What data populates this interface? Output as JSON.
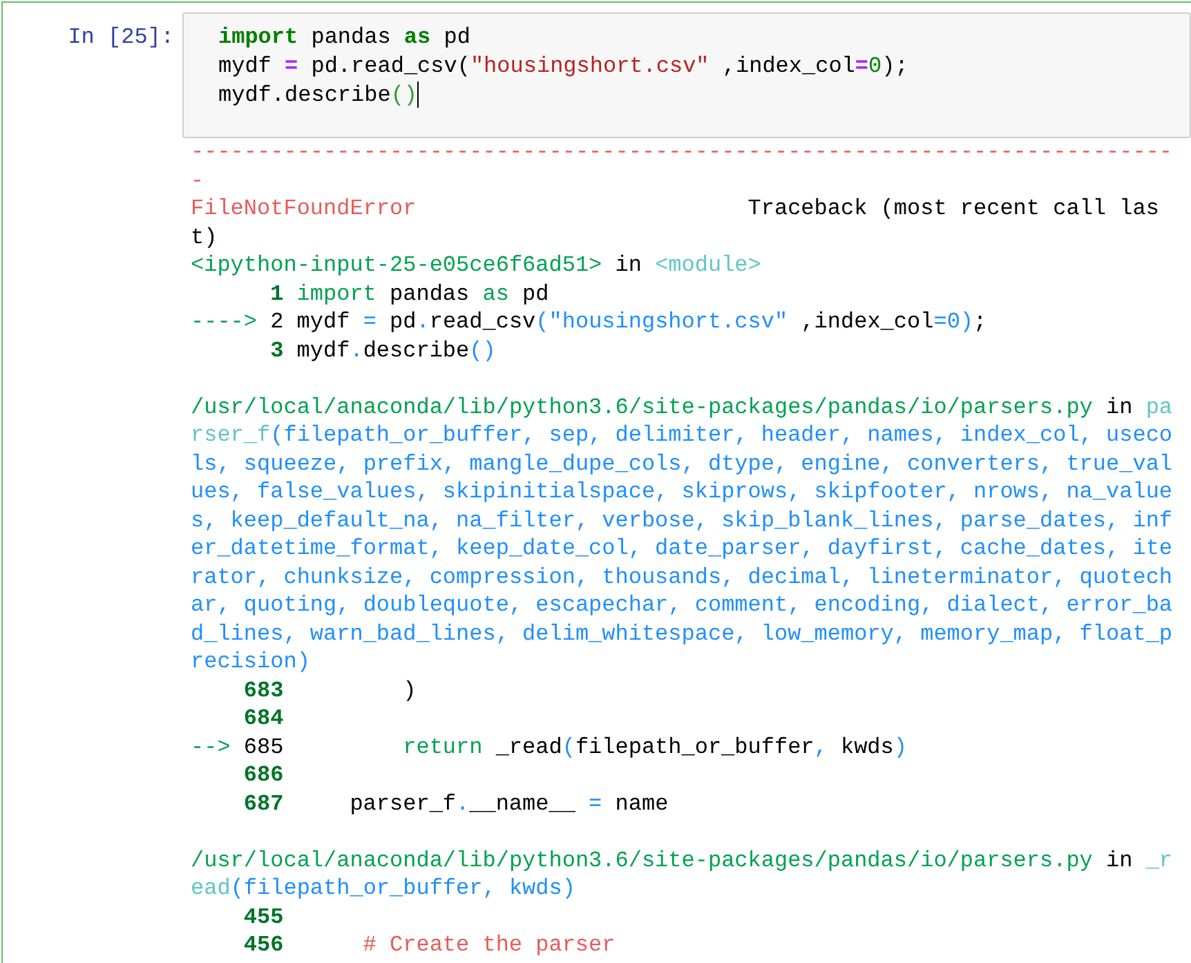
{
  "cell": {
    "selected": true,
    "prompt": "In [25]:",
    "input": {
      "cursor": true,
      "lines": [
        [
          {
            "kind": "keyword",
            "text": "import"
          },
          {
            "kind": "plain",
            "text": " pandas "
          },
          {
            "kind": "keyword",
            "text": "as"
          },
          {
            "kind": "plain",
            "text": " pd"
          }
        ],
        [
          {
            "kind": "plain",
            "text": "mydf "
          },
          {
            "kind": "operator",
            "text": "="
          },
          {
            "kind": "plain",
            "text": " pd.read_csv("
          },
          {
            "kind": "string",
            "text": "\"housingshort.csv\""
          },
          {
            "kind": "plain",
            "text": " ,index_col"
          },
          {
            "kind": "operator",
            "text": "="
          },
          {
            "kind": "number",
            "text": "0"
          },
          {
            "kind": "plain",
            "text": ");"
          }
        ],
        [
          {
            "kind": "plain",
            "text": "mydf.describe"
          },
          {
            "kind": "paren",
            "text": "()"
          }
        ]
      ]
    },
    "output": [
      {
        "kind": "text",
        "segments": [
          {
            "kind": "red",
            "text": "--------------------------------------------------------------------------"
          }
        ]
      },
      {
        "kind": "text",
        "segments": [
          {
            "kind": "red",
            "text": "-"
          }
        ]
      },
      {
        "kind": "text",
        "segments": [
          {
            "kind": "red",
            "text": "FileNotFoundError"
          },
          {
            "kind": "plain",
            "text": "                         Traceback (most recent call las"
          }
        ]
      },
      {
        "kind": "text",
        "segments": [
          {
            "kind": "plain",
            "text": "t)"
          }
        ]
      },
      {
        "kind": "text",
        "segments": [
          {
            "kind": "green",
            "text": "<ipython-input-25-e05ce6f6ad51>"
          },
          {
            "kind": "plain",
            "text": " in "
          },
          {
            "kind": "cyan",
            "text": "<module>"
          }
        ]
      },
      {
        "kind": "source",
        "current": false,
        "lineno": "1",
        "segments": [
          {
            "kind": "green",
            "text": "import"
          },
          {
            "kind": "plain",
            "text": " pandas "
          },
          {
            "kind": "green",
            "text": "as"
          },
          {
            "kind": "plain",
            "text": " pd"
          }
        ]
      },
      {
        "kind": "source",
        "current": true,
        "marker": "---->",
        "lineno": "2",
        "segments": [
          {
            "kind": "plain",
            "text": "mydf "
          },
          {
            "kind": "blue",
            "text": "="
          },
          {
            "kind": "plain",
            "text": " pd"
          },
          {
            "kind": "blue",
            "text": "."
          },
          {
            "kind": "plain",
            "text": "read_csv"
          },
          {
            "kind": "blue",
            "text": "(\"housingshort.csv\""
          },
          {
            "kind": "plain",
            "text": " ,index_col"
          },
          {
            "kind": "blue",
            "text": "=0)"
          },
          {
            "kind": "plain",
            "text": ";"
          }
        ]
      },
      {
        "kind": "source",
        "current": false,
        "lineno": "3",
        "segments": [
          {
            "kind": "plain",
            "text": "mydf"
          },
          {
            "kind": "blue",
            "text": "."
          },
          {
            "kind": "plain",
            "text": "describe"
          },
          {
            "kind": "blue",
            "text": "()"
          }
        ]
      },
      {
        "kind": "blank"
      },
      {
        "kind": "text",
        "segments": [
          {
            "kind": "green",
            "text": "/usr/local/anaconda/lib/python3.6/site-packages/pandas/io/parsers.py"
          },
          {
            "kind": "plain",
            "text": " in "
          },
          {
            "kind": "cyan",
            "text": "pa"
          }
        ]
      },
      {
        "kind": "text",
        "segments": [
          {
            "kind": "cyan",
            "text": "rser_f"
          },
          {
            "kind": "blue",
            "text": "(filepath_or_buffer, sep, delimiter, header, names, index_col, useco"
          }
        ]
      },
      {
        "kind": "text",
        "segments": [
          {
            "kind": "blue",
            "text": "ls, squeeze, prefix, mangle_dupe_cols, dtype, engine, converters, true_val"
          }
        ]
      },
      {
        "kind": "text",
        "segments": [
          {
            "kind": "blue",
            "text": "ues, false_values, skipinitialspace, skiprows, skipfooter, nrows, na_value"
          }
        ]
      },
      {
        "kind": "text",
        "segments": [
          {
            "kind": "blue",
            "text": "s, keep_default_na, na_filter, verbose, skip_blank_lines, parse_dates, inf"
          }
        ]
      },
      {
        "kind": "text",
        "segments": [
          {
            "kind": "blue",
            "text": "er_datetime_format, keep_date_col, date_parser, dayfirst, cache_dates, ite"
          }
        ]
      },
      {
        "kind": "text",
        "segments": [
          {
            "kind": "blue",
            "text": "rator, chunksize, compression, thousands, decimal, lineterminator, quotech"
          }
        ]
      },
      {
        "kind": "text",
        "segments": [
          {
            "kind": "blue",
            "text": "ar, quoting, doublequote, escapechar, comment, encoding, dialect, error_ba"
          }
        ]
      },
      {
        "kind": "text",
        "segments": [
          {
            "kind": "blue",
            "text": "d_lines, warn_bad_lines, delim_whitespace, low_memory, memory_map, float_p"
          }
        ]
      },
      {
        "kind": "text",
        "segments": [
          {
            "kind": "blue",
            "text": "recision)"
          }
        ]
      },
      {
        "kind": "source",
        "current": false,
        "lineno": "683",
        "segments": [
          {
            "kind": "plain",
            "text": "        )"
          }
        ]
      },
      {
        "kind": "source",
        "current": false,
        "lineno": "684"
      },
      {
        "kind": "source",
        "current": true,
        "marker": "-->",
        "lineno": "685",
        "segments": [
          {
            "kind": "green",
            "text": "        return"
          },
          {
            "kind": "plain",
            "text": " _read"
          },
          {
            "kind": "blue",
            "text": "("
          },
          {
            "kind": "plain",
            "text": "filepath_or_buffer"
          },
          {
            "kind": "blue",
            "text": ","
          },
          {
            "kind": "plain",
            "text": " kwds"
          },
          {
            "kind": "blue",
            "text": ")"
          }
        ]
      },
      {
        "kind": "source",
        "current": false,
        "lineno": "686"
      },
      {
        "kind": "source",
        "current": false,
        "lineno": "687",
        "segments": [
          {
            "kind": "plain",
            "text": "    parser_f"
          },
          {
            "kind": "blue",
            "text": "."
          },
          {
            "kind": "plain",
            "text": "__name__ "
          },
          {
            "kind": "blue",
            "text": "="
          },
          {
            "kind": "plain",
            "text": " name"
          }
        ]
      },
      {
        "kind": "blank"
      },
      {
        "kind": "text",
        "segments": [
          {
            "kind": "green",
            "text": "/usr/local/anaconda/lib/python3.6/site-packages/pandas/io/parsers.py"
          },
          {
            "kind": "plain",
            "text": " in "
          },
          {
            "kind": "cyan",
            "text": "_r"
          }
        ]
      },
      {
        "kind": "text",
        "segments": [
          {
            "kind": "cyan",
            "text": "ead"
          },
          {
            "kind": "blue",
            "text": "(filepath_or_buffer, kwds)"
          }
        ]
      },
      {
        "kind": "source",
        "current": false,
        "lineno": "455"
      },
      {
        "kind": "source",
        "current": false,
        "lineno": "456",
        "segments": [
          {
            "kind": "red",
            "text": "     # Create the parser"
          }
        ]
      }
    ]
  }
}
